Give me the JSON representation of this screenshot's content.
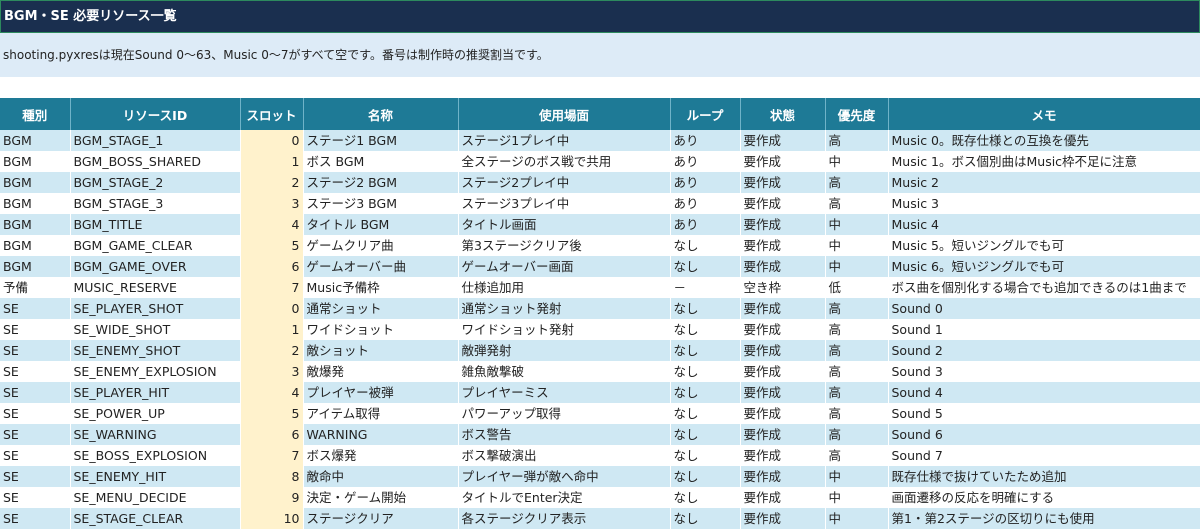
{
  "sheet": {
    "title": "BGM・SE 必要リソース一覧",
    "note": "shooting.pyxresは現在Sound 0〜63、Music 0〜7がすべて空です。番号は制作時の推奨割当です。"
  },
  "table": {
    "headers": {
      "type": "種別",
      "id": "リソースID",
      "slot": "スロット",
      "name": "名称",
      "scene": "使用場面",
      "loop": "ループ",
      "state": "状態",
      "priority": "優先度",
      "memo": "メモ"
    },
    "rows": [
      {
        "type": "BGM",
        "id": "BGM_STAGE_1",
        "slot": "0",
        "name": "ステージ1 BGM",
        "scene": "ステージ1プレイ中",
        "loop": "あり",
        "state": "要作成",
        "priority": "高",
        "memo": "Music 0。既存仕様との互換を優先"
      },
      {
        "type": "BGM",
        "id": "BGM_BOSS_SHARED",
        "slot": "1",
        "name": "ボス BGM",
        "scene": "全ステージのボス戦で共用",
        "loop": "あり",
        "state": "要作成",
        "priority": "中",
        "memo": "Music 1。ボス個別曲はMusic枠不足に注意"
      },
      {
        "type": "BGM",
        "id": "BGM_STAGE_2",
        "slot": "2",
        "name": "ステージ2 BGM",
        "scene": "ステージ2プレイ中",
        "loop": "あり",
        "state": "要作成",
        "priority": "高",
        "memo": "Music 2"
      },
      {
        "type": "BGM",
        "id": "BGM_STAGE_3",
        "slot": "3",
        "name": "ステージ3 BGM",
        "scene": "ステージ3プレイ中",
        "loop": "あり",
        "state": "要作成",
        "priority": "高",
        "memo": "Music 3"
      },
      {
        "type": "BGM",
        "id": "BGM_TITLE",
        "slot": "4",
        "name": "タイトル BGM",
        "scene": "タイトル画面",
        "loop": "あり",
        "state": "要作成",
        "priority": "中",
        "memo": "Music 4"
      },
      {
        "type": "BGM",
        "id": "BGM_GAME_CLEAR",
        "slot": "5",
        "name": "ゲームクリア曲",
        "scene": "第3ステージクリア後",
        "loop": "なし",
        "state": "要作成",
        "priority": "中",
        "memo": "Music 5。短いジングルでも可"
      },
      {
        "type": "BGM",
        "id": "BGM_GAME_OVER",
        "slot": "6",
        "name": "ゲームオーバー曲",
        "scene": "ゲームオーバー画面",
        "loop": "なし",
        "state": "要作成",
        "priority": "中",
        "memo": "Music 6。短いジングルでも可"
      },
      {
        "type": "予備",
        "id": "MUSIC_RESERVE",
        "slot": "7",
        "name": "Music予備枠",
        "scene": "仕様追加用",
        "loop": "－",
        "state": "空き枠",
        "priority": "低",
        "memo": "ボス曲を個別化する場合でも追加できるのは1曲まで"
      },
      {
        "type": "SE",
        "id": "SE_PLAYER_SHOT",
        "slot": "0",
        "name": "通常ショット",
        "scene": "通常ショット発射",
        "loop": "なし",
        "state": "要作成",
        "priority": "高",
        "memo": "Sound 0"
      },
      {
        "type": "SE",
        "id": "SE_WIDE_SHOT",
        "slot": "1",
        "name": "ワイドショット",
        "scene": "ワイドショット発射",
        "loop": "なし",
        "state": "要作成",
        "priority": "高",
        "memo": "Sound 1"
      },
      {
        "type": "SE",
        "id": "SE_ENEMY_SHOT",
        "slot": "2",
        "name": "敵ショット",
        "scene": "敵弾発射",
        "loop": "なし",
        "state": "要作成",
        "priority": "高",
        "memo": "Sound 2"
      },
      {
        "type": "SE",
        "id": "SE_ENEMY_EXPLOSION",
        "slot": "3",
        "name": "敵爆発",
        "scene": "雑魚敵撃破",
        "loop": "なし",
        "state": "要作成",
        "priority": "高",
        "memo": "Sound 3"
      },
      {
        "type": "SE",
        "id": "SE_PLAYER_HIT",
        "slot": "4",
        "name": "プレイヤー被弾",
        "scene": "プレイヤーミス",
        "loop": "なし",
        "state": "要作成",
        "priority": "高",
        "memo": "Sound 4"
      },
      {
        "type": "SE",
        "id": "SE_POWER_UP",
        "slot": "5",
        "name": "アイテム取得",
        "scene": "パワーアップ取得",
        "loop": "なし",
        "state": "要作成",
        "priority": "高",
        "memo": "Sound 5"
      },
      {
        "type": "SE",
        "id": "SE_WARNING",
        "slot": "6",
        "name": "WARNING",
        "scene": "ボス警告",
        "loop": "なし",
        "state": "要作成",
        "priority": "高",
        "memo": "Sound 6"
      },
      {
        "type": "SE",
        "id": "SE_BOSS_EXPLOSION",
        "slot": "7",
        "name": "ボス爆発",
        "scene": "ボス撃破演出",
        "loop": "なし",
        "state": "要作成",
        "priority": "高",
        "memo": "Sound 7"
      },
      {
        "type": "SE",
        "id": "SE_ENEMY_HIT",
        "slot": "8",
        "name": "敵命中",
        "scene": "プレイヤー弾が敵へ命中",
        "loop": "なし",
        "state": "要作成",
        "priority": "中",
        "memo": "既存仕様で抜けていたため追加"
      },
      {
        "type": "SE",
        "id": "SE_MENU_DECIDE",
        "slot": "9",
        "name": "決定・ゲーム開始",
        "scene": "タイトルでEnter決定",
        "loop": "なし",
        "state": "要作成",
        "priority": "中",
        "memo": "画面遷移の反応を明確にする"
      },
      {
        "type": "SE",
        "id": "SE_STAGE_CLEAR",
        "slot": "10",
        "name": "ステージクリア",
        "scene": "各ステージクリア表示",
        "loop": "なし",
        "state": "要作成",
        "priority": "中",
        "memo": "第1・第2ステージの区切りにも使用"
      }
    ]
  },
  "colors": {
    "title_bg": "#1a2f4f",
    "header_bg": "#1e7a96",
    "band_bg": "#cfe8f3",
    "slot_bg": "#fff2cc",
    "note_bg": "#ddebf7"
  }
}
